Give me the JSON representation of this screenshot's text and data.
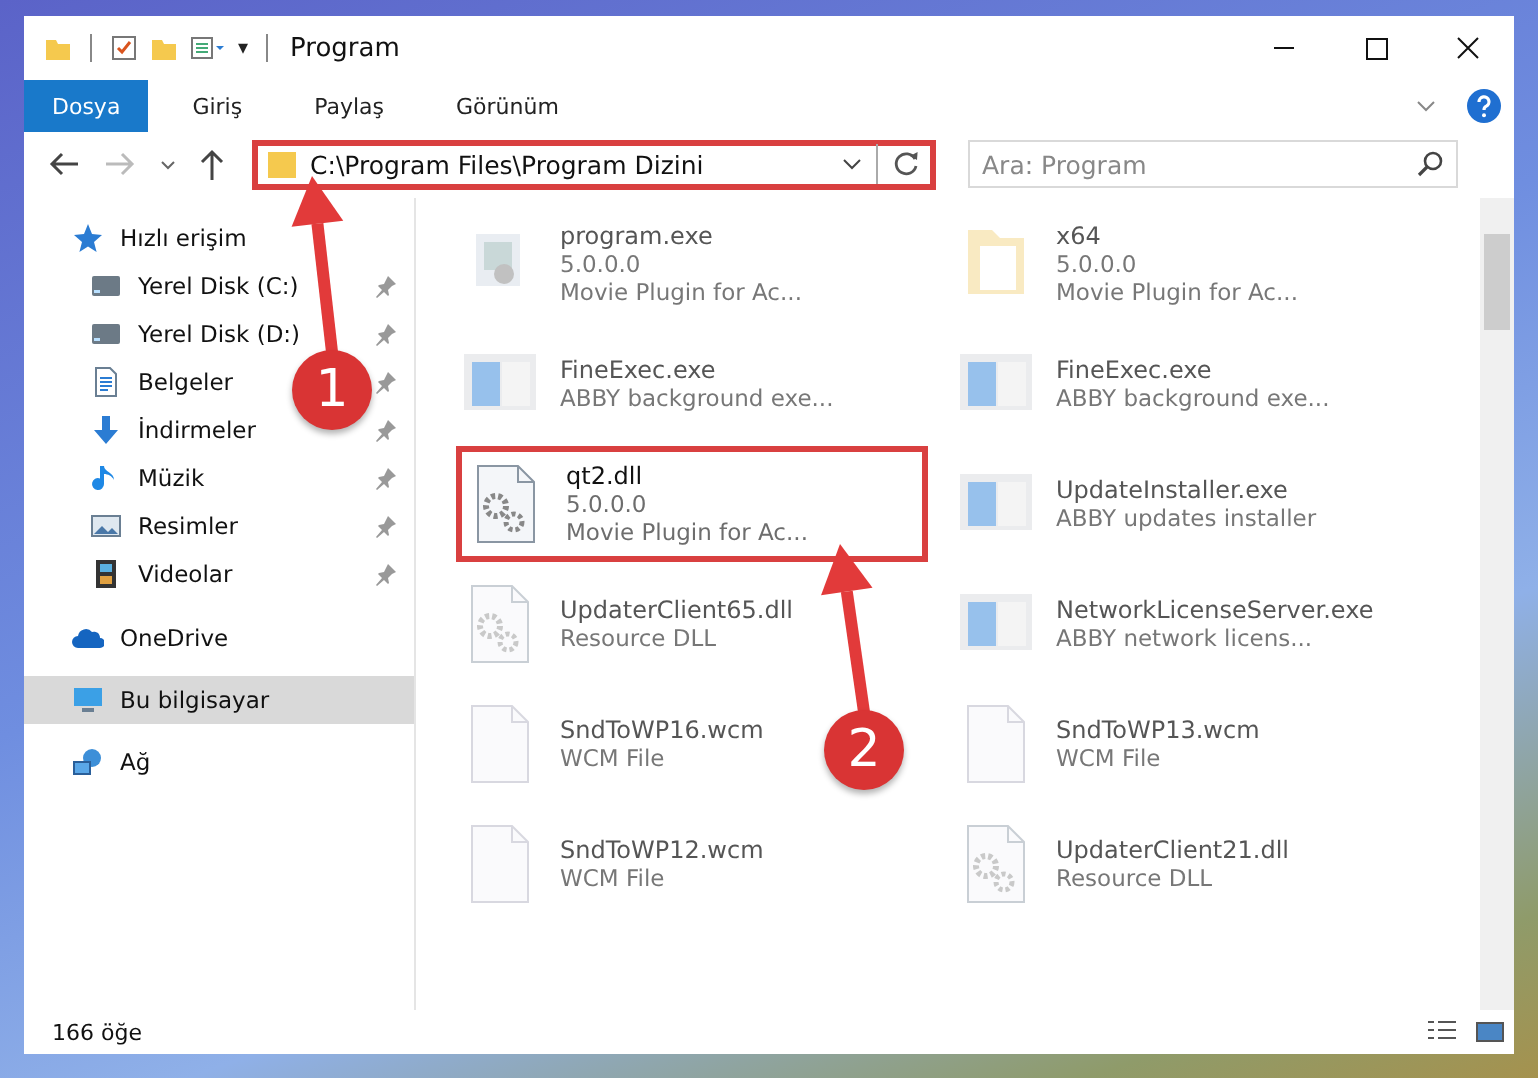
{
  "window": {
    "title": "Program"
  },
  "quick_toolbar": [
    "▾"
  ],
  "ribbon_tabs": [
    {
      "label": "Dosya",
      "selected": true
    },
    {
      "label": "Giriş",
      "selected": false
    },
    {
      "label": "Paylaş",
      "selected": false
    },
    {
      "label": "Görünüm",
      "selected": false
    }
  ],
  "address_bar": {
    "path": "C:\\Program Files\\Program Dizini",
    "highlighted": true
  },
  "search": {
    "placeholder": "Ara: Program"
  },
  "sidebar": {
    "items": [
      {
        "label": "Hızlı erişim",
        "kind": "star",
        "selected": false,
        "children": [
          {
            "label": "Yerel Disk (C:)",
            "kind": "drive",
            "pinned": true
          },
          {
            "label": "Yerel Disk (D:)",
            "kind": "drive",
            "pinned": true
          },
          {
            "label": "Belgeler",
            "kind": "document",
            "pinned": true
          },
          {
            "label": "İndirmeler",
            "kind": "download",
            "pinned": true
          },
          {
            "label": "Müzik",
            "kind": "music",
            "pinned": true
          },
          {
            "label": "Resimler",
            "kind": "picture",
            "pinned": true
          },
          {
            "label": "Videolar",
            "kind": "film",
            "pinned": true
          }
        ]
      },
      {
        "label": "OneDrive",
        "kind": "cloud",
        "selected": false
      },
      {
        "label": "Bu bilgisayar",
        "kind": "computer",
        "selected": true
      },
      {
        "label": "Ağ",
        "kind": "network",
        "selected": false
      }
    ]
  },
  "files": [
    {
      "name": "program.exe",
      "lines": [
        "5.0.0.0",
        "Movie Plugin for Ac..."
      ],
      "kind": "app",
      "dimmed": true,
      "highlighted": false
    },
    {
      "name": "x64",
      "lines": [
        "5.0.0.0",
        "Movie Plugin for Ac..."
      ],
      "kind": "folder",
      "dimmed": true,
      "highlighted": false
    },
    {
      "name": "FineExec.exe",
      "lines": [
        "ABBY background exe..."
      ],
      "kind": "window",
      "dimmed": true,
      "highlighted": false
    },
    {
      "name": "FineExec.exe",
      "lines": [
        "ABBY background exe..."
      ],
      "kind": "window",
      "dimmed": true,
      "highlighted": false
    },
    {
      "name": "qt2.dll",
      "lines": [
        "5.0.0.0",
        "Movie Plugin for Ac..."
      ],
      "kind": "gears",
      "dimmed": false,
      "highlighted": true
    },
    {
      "name": "UpdateInstaller.exe",
      "lines": [
        "ABBY updates installer"
      ],
      "kind": "window",
      "dimmed": true,
      "highlighted": false
    },
    {
      "name": "UpdaterClient65.dll",
      "lines": [
        "Resource DLL"
      ],
      "kind": "gears",
      "dimmed": true,
      "highlighted": false
    },
    {
      "name": "NetworkLicenseServer.exe",
      "lines": [
        "ABBY network licens..."
      ],
      "kind": "window",
      "dimmed": true,
      "highlighted": false
    },
    {
      "name": "SndToWP16.wcm",
      "lines": [
        "WCM File"
      ],
      "kind": "blank",
      "dimmed": true,
      "highlighted": false
    },
    {
      "name": "SndToWP13.wcm",
      "lines": [
        "WCM File"
      ],
      "kind": "blank",
      "dimmed": true,
      "highlighted": false
    },
    {
      "name": "SndToWP12.wcm",
      "lines": [
        "WCM File"
      ],
      "kind": "blank",
      "dimmed": true,
      "highlighted": false
    },
    {
      "name": "UpdaterClient21.dll",
      "lines": [
        "Resource DLL"
      ],
      "kind": "gears",
      "dimmed": true,
      "highlighted": false
    }
  ],
  "status_bar": {
    "count": "166 öğe"
  },
  "callouts": [
    {
      "number": "1"
    },
    {
      "number": "2"
    }
  ]
}
